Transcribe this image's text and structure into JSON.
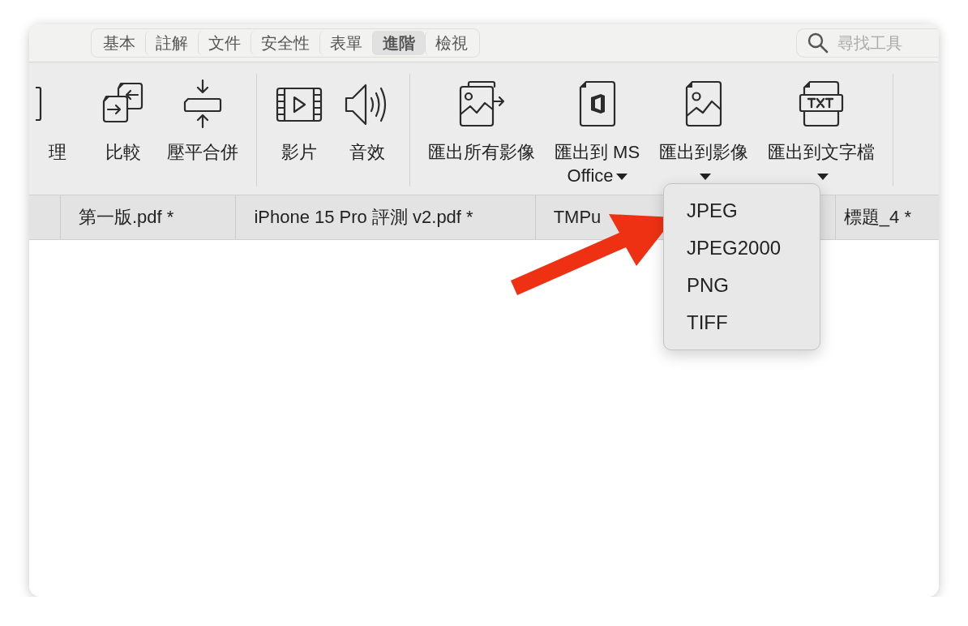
{
  "window": {
    "segments": [
      {
        "label": "基本",
        "selected": false
      },
      {
        "label": "註解",
        "selected": false
      },
      {
        "label": "文件",
        "selected": false
      },
      {
        "label": "安全性",
        "selected": false
      },
      {
        "label": "表單",
        "selected": false
      },
      {
        "label": "進階",
        "selected": true
      },
      {
        "label": "檢視",
        "selected": false
      }
    ],
    "search": {
      "placeholder": "尋找工具"
    }
  },
  "toolbar": {
    "groups": [
      [
        {
          "lines": [
            "理"
          ],
          "dropdown": false
        },
        {
          "lines": [
            "比較"
          ],
          "dropdown": false
        },
        {
          "lines": [
            "壓平合併"
          ],
          "dropdown": false
        }
      ],
      [
        {
          "lines": [
            "影片"
          ],
          "dropdown": false
        },
        {
          "lines": [
            "音效"
          ],
          "dropdown": false
        }
      ],
      [
        {
          "lines": [
            "匯出所有影像"
          ],
          "dropdown": false
        },
        {
          "lines": [
            "匯出到 MS",
            "Office"
          ],
          "dropdown": true
        },
        {
          "lines": [
            "匯出到影像"
          ],
          "dropdown": true
        },
        {
          "lines": [
            "匯出到文字檔"
          ],
          "dropdown": true
        }
      ]
    ]
  },
  "document_tabs": [
    {
      "label": "第一版.pdf *"
    },
    {
      "label": "iPhone 15 Pro 評測 v2.pdf *"
    },
    {
      "label": "TMPu"
    },
    {
      "label": "標題_4 *"
    }
  ],
  "dropdown_menu": {
    "items": [
      "JPEG",
      "JPEG2000",
      "PNG",
      "TIFF"
    ]
  }
}
